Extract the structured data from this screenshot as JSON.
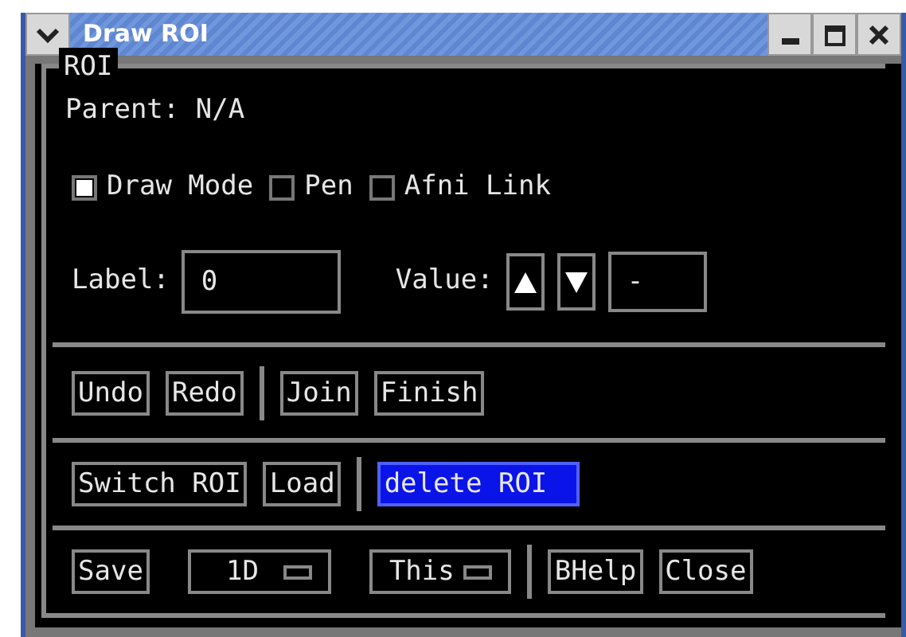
{
  "window": {
    "title": "Draw ROI"
  },
  "frame": {
    "title": "ROI"
  },
  "parent": "Parent: N/A",
  "toggles": [
    {
      "label": "Draw Mode",
      "checked": true
    },
    {
      "label": "Pen",
      "checked": false
    },
    {
      "label": "Afni Link",
      "checked": false
    }
  ],
  "label_field": {
    "label": "Label:",
    "value": "0"
  },
  "value_field": {
    "label": "Value:",
    "value": "-"
  },
  "button_rows": [
    {
      "items": [
        {
          "kind": "button",
          "label": "Undo"
        },
        {
          "kind": "button",
          "label": "Redo"
        },
        {
          "kind": "separator"
        },
        {
          "kind": "button",
          "label": "Join"
        },
        {
          "kind": "button",
          "label": "Finish"
        }
      ]
    },
    {
      "items": [
        {
          "kind": "button",
          "label": "Switch ROI"
        },
        {
          "kind": "button",
          "label": "Load"
        },
        {
          "kind": "separator"
        },
        {
          "kind": "highlighted",
          "label": "delete ROI"
        }
      ]
    },
    {
      "items": [
        {
          "kind": "button",
          "label": "Save"
        },
        {
          "kind": "option",
          "label": "1D"
        },
        {
          "kind": "option",
          "label": "This"
        },
        {
          "kind": "separator"
        },
        {
          "kind": "button",
          "label": "BHelp"
        },
        {
          "kind": "button",
          "label": "Close"
        }
      ]
    }
  ]
}
